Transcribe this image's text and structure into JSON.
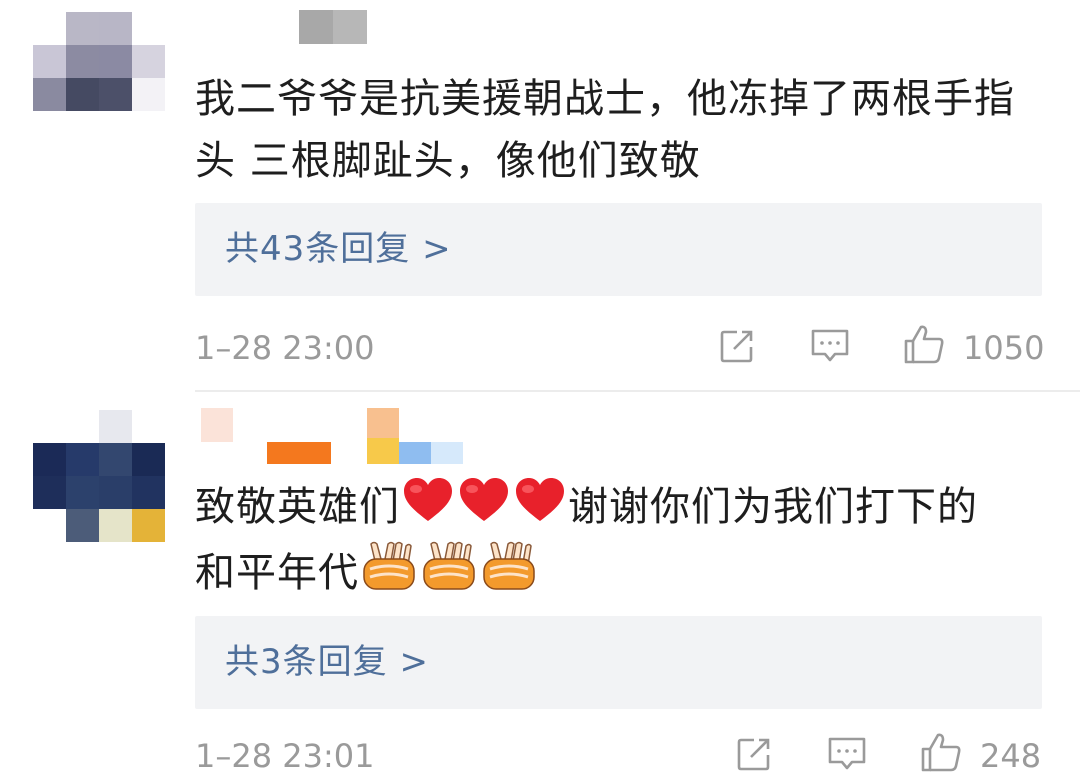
{
  "comments": [
    {
      "text_line1": "我二爷爷是抗美援朝战士，他冻掉了两根手指",
      "text_line2": "头 三根脚趾头，像他们致敬",
      "replies_label": "共43条回复 >",
      "timestamp": "1–28 23:00",
      "likes": "1050"
    },
    {
      "text_part1": "致敬英雄们",
      "text_part2": "谢谢你们为我们打下的",
      "text_line2": "和平年代",
      "emoji_1": "red-heart",
      "emoji_2": "victory-hands",
      "replies_label": "共3条回复 >",
      "timestamp": "1–28 23:01",
      "likes": "248"
    }
  ],
  "icons": {
    "share": "share-icon",
    "reply": "comment-icon",
    "like": "thumbs-up-icon"
  },
  "colors": {
    "link": "#4f6f9a",
    "meta": "#9a9a9a",
    "reply_bg": "#f2f3f5",
    "heart": "#e8212b"
  }
}
